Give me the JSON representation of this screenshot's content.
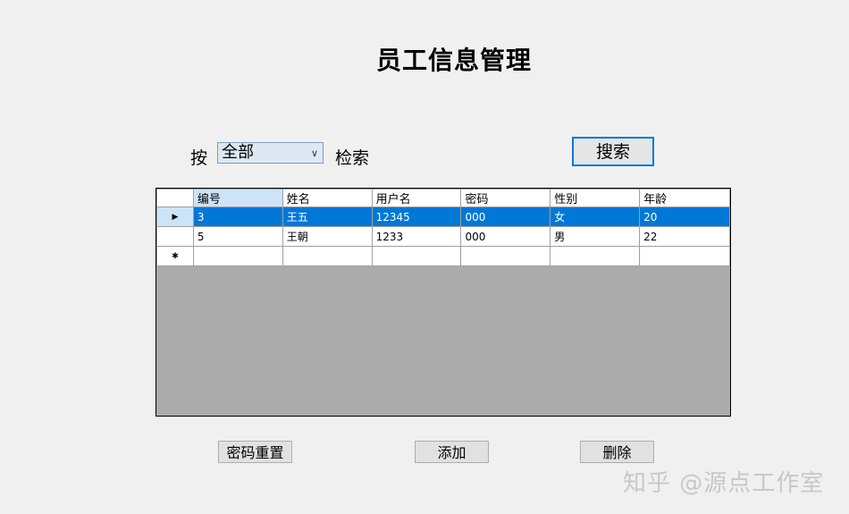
{
  "title": "员工信息管理",
  "search": {
    "prefix_label": "按",
    "field_value": "全部",
    "suffix_label": "检索",
    "button_label": "搜索"
  },
  "grid": {
    "columns": [
      "编号",
      "姓名",
      "用户名",
      "密码",
      "性别",
      "年龄"
    ],
    "rows": [
      [
        "3",
        "王五",
        "12345",
        "000",
        "女",
        "20"
      ],
      [
        "5",
        "王朝",
        "1233",
        "000",
        "男",
        "22"
      ]
    ],
    "selected_row": 0
  },
  "buttons": {
    "reset_password": "密码重置",
    "add": "添加",
    "delete": "删除"
  },
  "watermark": "知乎 @源点工作室",
  "icons": {
    "current_row": "triangle-right-icon",
    "new_row": "asterisk-icon",
    "dropdown": "chevron-down-icon"
  },
  "colors": {
    "selection": "#0078d7",
    "header_selected": "#cce4f7",
    "grid_background": "#ababab"
  }
}
